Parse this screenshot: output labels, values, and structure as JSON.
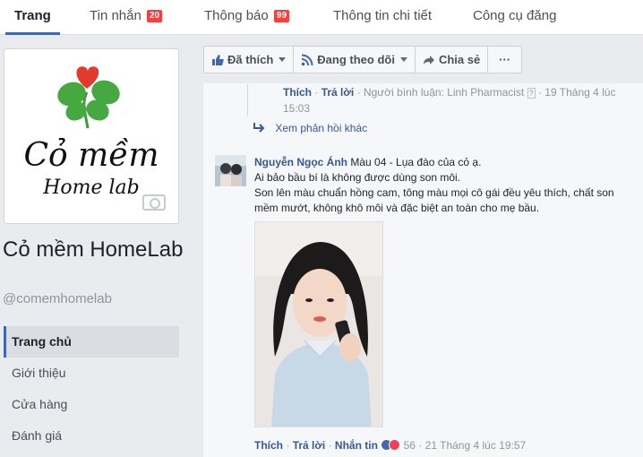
{
  "tabs": [
    {
      "label": "Trang",
      "badge": ""
    },
    {
      "label": "Tin nhắn",
      "badge": "20"
    },
    {
      "label": "Thông báo",
      "badge": "99"
    },
    {
      "label": "Thông tin chi tiết",
      "badge": ""
    },
    {
      "label": "Công cụ đăng",
      "badge": ""
    }
  ],
  "logo": {
    "line1": "Cỏ mềm",
    "line2": "Home lab"
  },
  "page": {
    "name": "Cỏ mềm HomeLab",
    "handle": "@comemhomelab"
  },
  "nav": [
    "Trang chủ",
    "Giới thiệu",
    "Cửa hàng",
    "Đánh giá"
  ],
  "actions": {
    "liked": "Đã thích",
    "following": "Đang theo dõi",
    "share": "Chia sẻ",
    "more": "···"
  },
  "reply": {
    "like": "Thích",
    "reply": "Trả lời",
    "commenter_info": "Người bình luận: Linh Pharmacist",
    "time": "19 Tháng 4 lúc 15:03"
  },
  "more_replies": "Xem phản hồi khác",
  "comment": {
    "author": "Nguyễn Ngọc Ánh",
    "line1": "Màu 04 - Lụa đào của cỏ ạ.",
    "line2": "Ai bảo bầu bí là không được dùng son môi.",
    "line3": "Son lên màu chuẩn hồng cam, tông màu mọi cô gái đều yêu thích, chất son mềm mướt, không khô môi và đặc biệt an toàn cho mẹ bầu.",
    "like": "Thích",
    "reply": "Trả lời",
    "message": "Nhắn tin",
    "reactions": "56",
    "time": "21 Tháng 4 lúc 19:57"
  },
  "colors": {
    "accent": "#4267b2",
    "link": "#365899",
    "badge": "#fa3e3e"
  }
}
